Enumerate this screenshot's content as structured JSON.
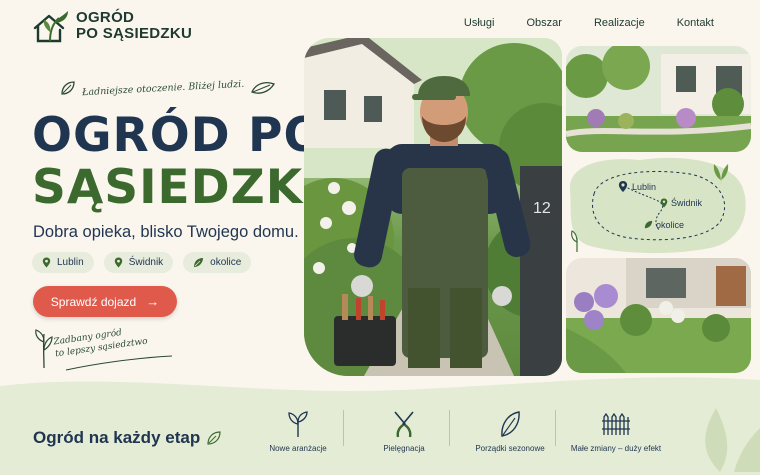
{
  "brand": {
    "line1": "OGRÓD",
    "line2": "PO SĄSIEDZKU"
  },
  "nav": [
    {
      "label": "Usługi"
    },
    {
      "label": "Obszar"
    },
    {
      "label": "Realizacje"
    },
    {
      "label": "Kontakt"
    }
  ],
  "hero": {
    "tagline": "Ładniejsze otoczenie. Bliżej ludzi.",
    "title_line1": "OGRÓD PO",
    "title_line2": "SĄSIEDZKU",
    "subtitle": "Dobra opieka, blisko Twojego domu.",
    "chips": [
      {
        "label": "Lublin",
        "icon": "pin-icon"
      },
      {
        "label": "Świdnik",
        "icon": "pin-icon"
      },
      {
        "label": "okolice",
        "icon": "leaf-icon"
      }
    ],
    "cta_label": "Sprawdź dojazd",
    "cta_arrow": "→",
    "note_line1": "Zadbany ogród",
    "note_line2": "to lepszy sąsiedztwo"
  },
  "photos": {
    "mailbox_number": "12"
  },
  "map": {
    "places": [
      {
        "label": "Lublin"
      },
      {
        "label": "Świdnik"
      },
      {
        "label": "okolice"
      }
    ]
  },
  "bottom": {
    "title": "Ogród na każdy etap",
    "features": [
      {
        "label": "Nowe aranżacje",
        "icon": "sprout-icon"
      },
      {
        "label": "Pielęgnacja",
        "icon": "pruning-shears-icon"
      },
      {
        "label": "Porządki sezonowe",
        "icon": "leaf-icon"
      },
      {
        "label": "Małe zmiany – duży efekt",
        "icon": "fence-icon"
      }
    ]
  },
  "colors": {
    "background": "#faf6ee",
    "navy": "#1f3550",
    "green": "#3c6a2e",
    "cta": "#e05a4c",
    "chip": "#e8ecdc",
    "bottom_band": "#e4ecd6"
  }
}
